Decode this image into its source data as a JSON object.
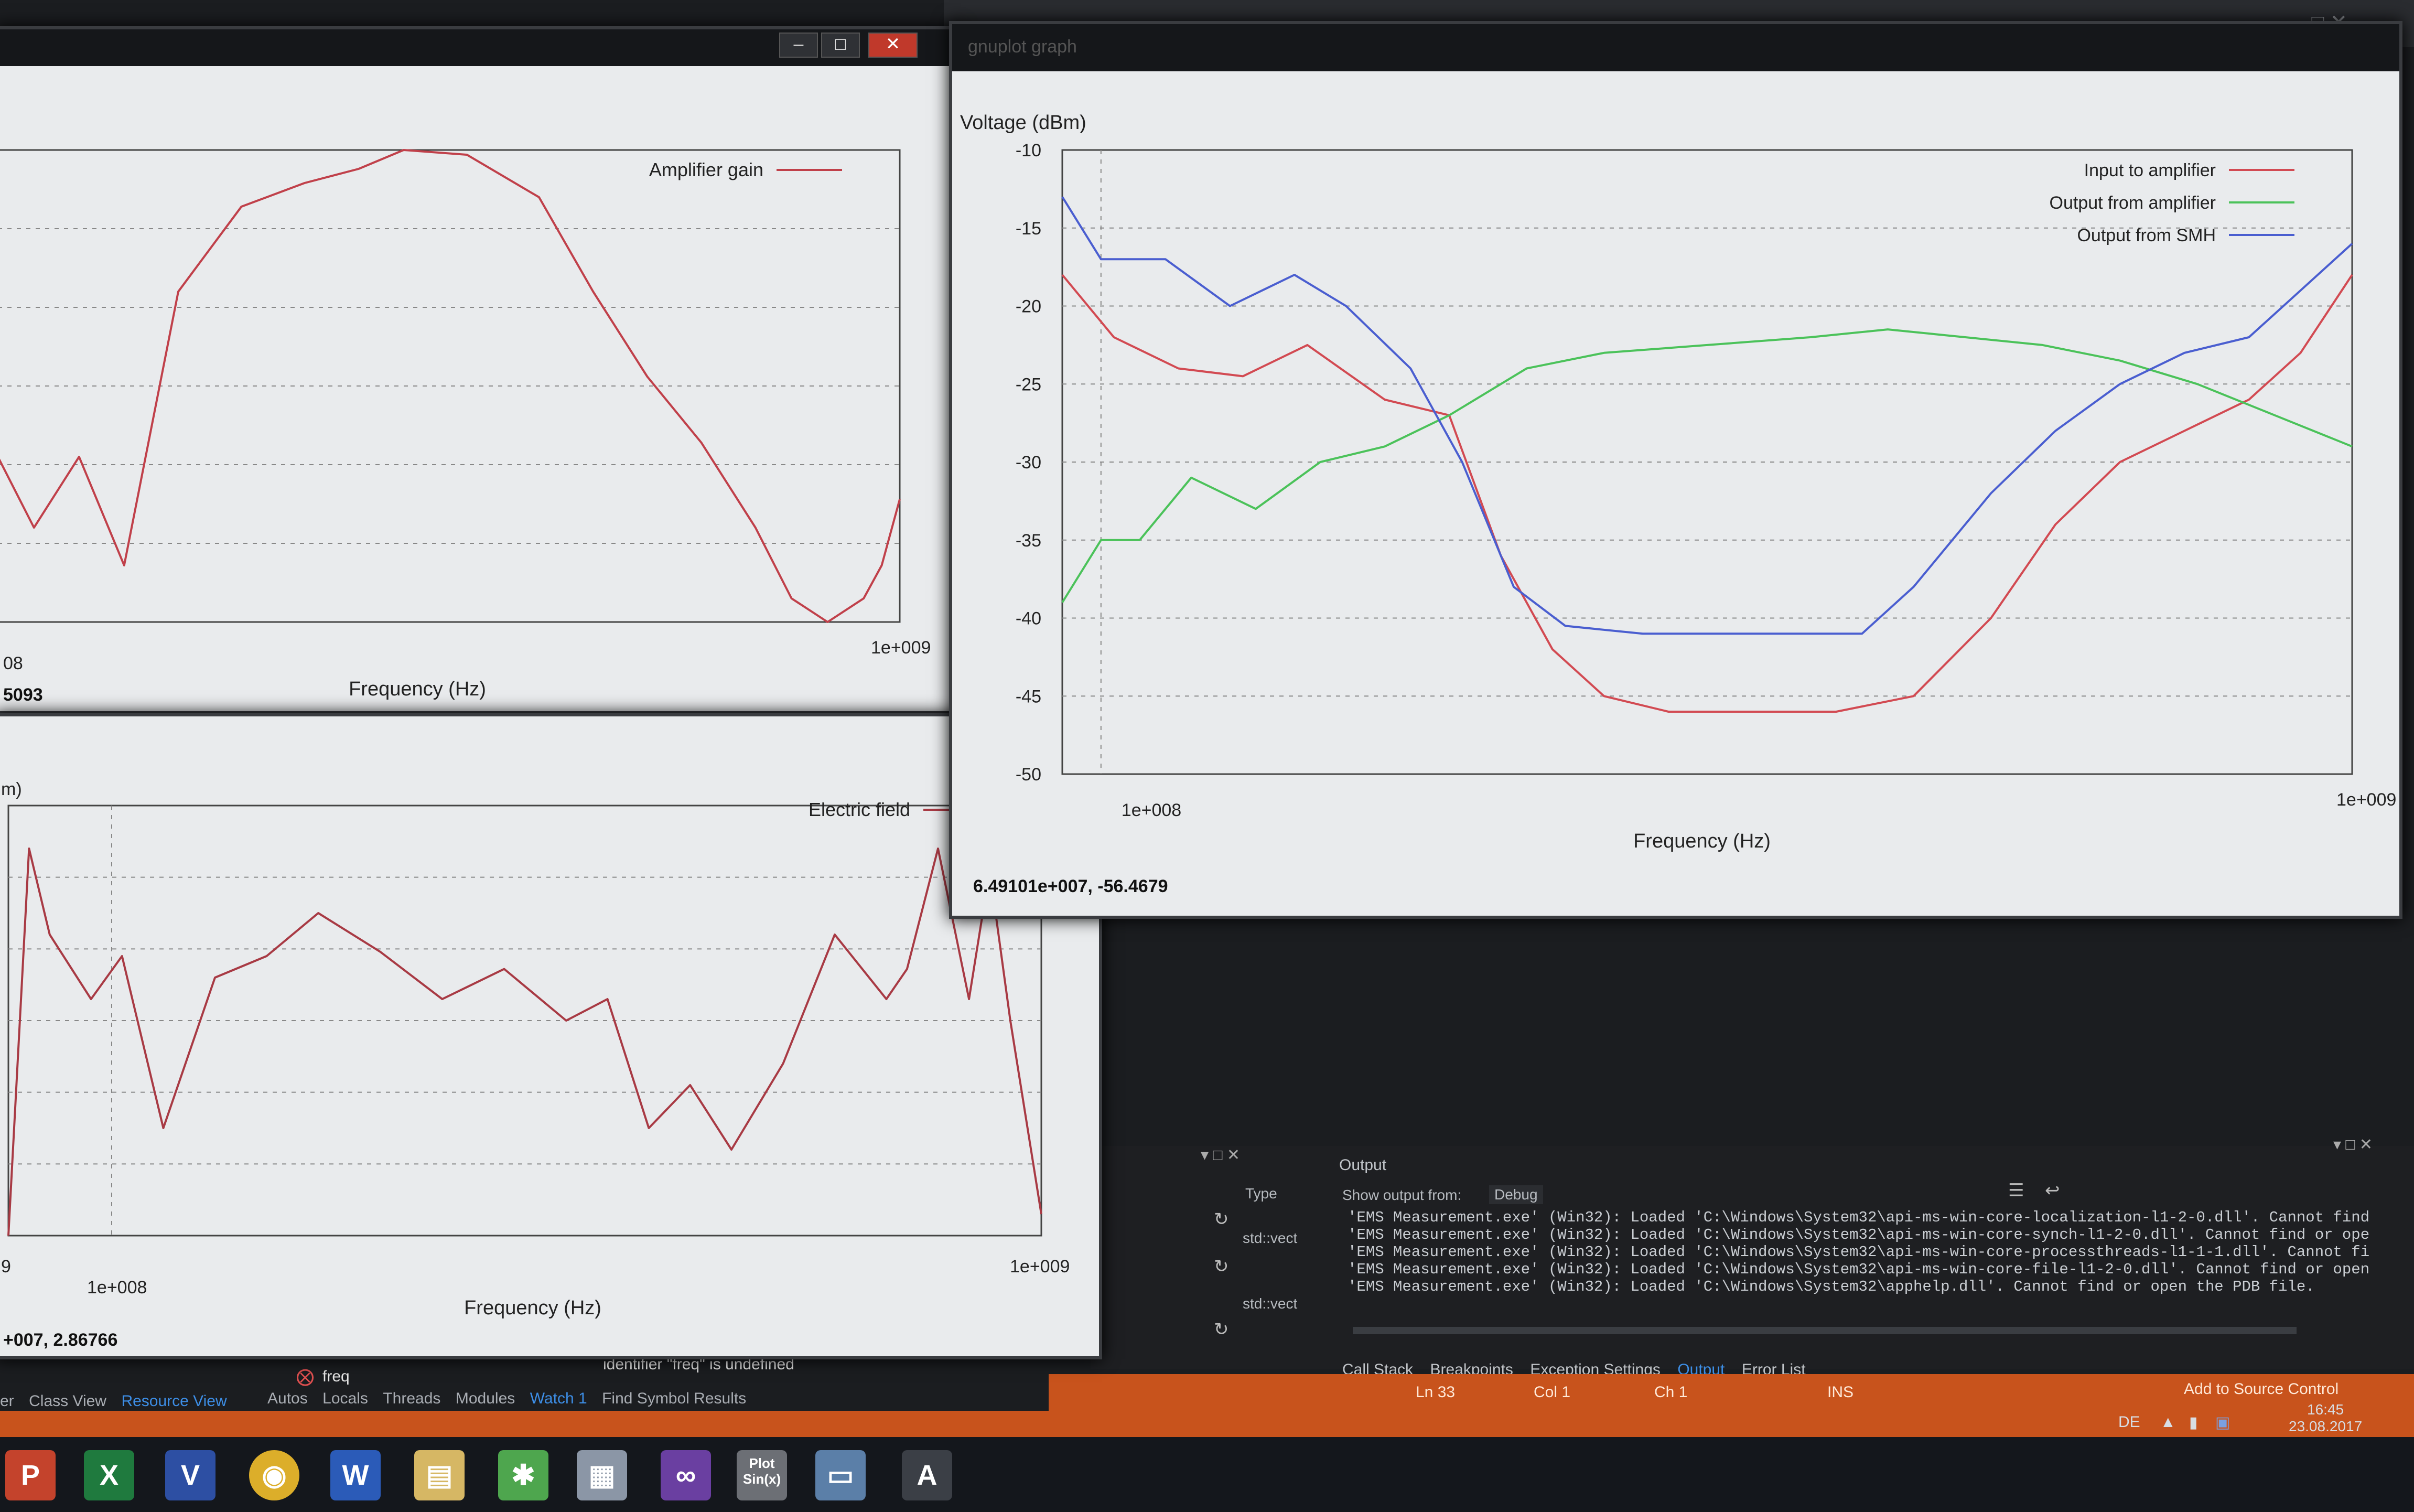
{
  "ide": {
    "output": {
      "title": "Output",
      "show_from_label": "Show output from:",
      "show_from_value": "Debug",
      "lines": [
        "'EMS Measurement.exe' (Win32): Loaded 'C:\\Windows\\System32\\api-ms-win-core-localization-l1-2-0.dll'. Cannot find",
        "'EMS Measurement.exe' (Win32): Loaded 'C:\\Windows\\System32\\api-ms-win-core-synch-l1-2-0.dll'. Cannot find or ope",
        "'EMS Measurement.exe' (Win32): Loaded 'C:\\Windows\\System32\\api-ms-win-core-processthreads-l1-1-1.dll'. Cannot fi",
        "'EMS Measurement.exe' (Win32): Loaded 'C:\\Windows\\System32\\api-ms-win-core-file-l1-2-0.dll'. Cannot find or open",
        "'EMS Measurement.exe' (Win32): Loaded 'C:\\Windows\\System32\\apphelp.dll'. Cannot find or open the PDB file."
      ],
      "tabs": [
        "Call Stack",
        "Breakpoints",
        "Exception Settings",
        "Output",
        "Error List"
      ],
      "active_tab": "Output"
    },
    "watch": {
      "type_header": "Type",
      "types": [
        "std::vect",
        "std::vect"
      ],
      "errors": [
        "identifier \"freq\" is undefined"
      ],
      "items": [
        "freq"
      ]
    },
    "lower_tabs": [
      "er",
      "Class View",
      "Resource View",
      "Autos",
      "Locals",
      "Threads",
      "Modules",
      "Watch 1",
      "Find Symbol Results"
    ],
    "lower_tabs_active": [
      "Resource View",
      "Watch 1"
    ],
    "status": {
      "ln": "Ln 33",
      "col": "Col 1",
      "ch": "Ch 1",
      "ins": "INS",
      "source_control": "Add to Source Control"
    },
    "tray": {
      "lang": "DE",
      "time": "16:45",
      "date": "23.08.2017"
    },
    "taskbar_plot_label": "Plot\nSin(x)"
  },
  "plots": {
    "amplifier_gain": {
      "coord": "5093",
      "xlabel": "Frequency (Hz)",
      "xtick_left": "08",
      "xtick_right": "1e+009",
      "chart_data": {
        "type": "line",
        "xlabel": "Frequency (Hz)",
        "series": [
          {
            "name": "Amplifier gain",
            "color": "#c0404a",
            "x": [
              0,
              0.04,
              0.09,
              0.14,
              0.2,
              0.27,
              0.34,
              0.4,
              0.45,
              0.52,
              0.6,
              0.66,
              0.72,
              0.78,
              0.84,
              0.88,
              0.92,
              0.96,
              0.98,
              1.0
            ],
            "y": [
              0.35,
              0.2,
              0.35,
              0.12,
              0.7,
              0.88,
              0.93,
              0.96,
              1.0,
              0.99,
              0.9,
              0.7,
              0.52,
              0.38,
              0.2,
              0.05,
              0.0,
              0.05,
              0.12,
              0.26
            ]
          }
        ]
      }
    },
    "electric_field": {
      "coord": "+007, 2.86766",
      "ylabel_fragment": "m)",
      "xlabel": "Frequency (Hz)",
      "xtick_left": "1e+008",
      "xtick_right": "1e+009",
      "xtick_far_left": "9",
      "chart_data": {
        "type": "line",
        "xlabel": "Frequency (Hz)",
        "series": [
          {
            "name": "Electric field",
            "color": "#a83a44",
            "x": [
              0,
              0.02,
              0.04,
              0.08,
              0.11,
              0.15,
              0.2,
              0.25,
              0.3,
              0.36,
              0.42,
              0.48,
              0.54,
              0.58,
              0.62,
              0.66,
              0.7,
              0.75,
              0.8,
              0.85,
              0.87,
              0.9,
              0.93,
              0.95,
              0.97,
              1.0
            ],
            "y": [
              0.0,
              0.9,
              0.7,
              0.55,
              0.65,
              0.25,
              0.6,
              0.65,
              0.75,
              0.66,
              0.55,
              0.62,
              0.5,
              0.55,
              0.25,
              0.35,
              0.2,
              0.4,
              0.7,
              0.55,
              0.62,
              0.9,
              0.55,
              0.85,
              0.5,
              0.05
            ]
          }
        ]
      }
    },
    "voltage": {
      "title": "gnuplot graph",
      "coord": "6.49101e+007, -56.4679",
      "ylabel": "Voltage (dBm)",
      "xlabel": "Frequency (Hz)",
      "yticks": [
        "-10",
        "-15",
        "-20",
        "-25",
        "-30",
        "-35",
        "-40",
        "-45",
        "-50"
      ],
      "xtick_left": "1e+008",
      "xtick_right": "1e+009",
      "chart_data": {
        "type": "line",
        "ylabel": "Voltage (dBm)",
        "xlabel": "Frequency (Hz)",
        "ylim": [
          -50,
          -10
        ],
        "xlim": [
          0,
          1
        ],
        "series": [
          {
            "name": "Input to amplifier",
            "color": "#d24a52",
            "x": [
              0,
              0.04,
              0.09,
              0.14,
              0.19,
              0.25,
              0.3,
              0.34,
              0.38,
              0.42,
              0.47,
              0.53,
              0.6,
              0.66,
              0.72,
              0.77,
              0.82,
              0.87,
              0.92,
              0.96,
              1.0
            ],
            "y": [
              -18,
              -22,
              -24,
              -24.5,
              -22.5,
              -26,
              -27,
              -36,
              -42,
              -45,
              -46,
              -46,
              -46,
              -45,
              -40,
              -34,
              -30,
              -28,
              -26,
              -23,
              -18
            ]
          },
          {
            "name": "Output from amplifier",
            "color": "#4bc25a",
            "x": [
              0,
              0.03,
              0.06,
              0.1,
              0.15,
              0.2,
              0.25,
              0.3,
              0.36,
              0.42,
              0.5,
              0.58,
              0.64,
              0.7,
              0.76,
              0.82,
              0.88,
              0.94,
              1.0
            ],
            "y": [
              -39,
              -35,
              -35,
              -31,
              -33,
              -30,
              -29,
              -27,
              -24,
              -23,
              -22.5,
              -22,
              -21.5,
              -22,
              -22.5,
              -23.5,
              -25,
              -27,
              -29
            ]
          },
          {
            "name": "Output from SMH",
            "color": "#4a5ed0",
            "x": [
              0,
              0.03,
              0.08,
              0.13,
              0.18,
              0.22,
              0.27,
              0.31,
              0.35,
              0.39,
              0.45,
              0.5,
              0.56,
              0.62,
              0.66,
              0.72,
              0.77,
              0.82,
              0.87,
              0.92,
              0.96,
              1.0
            ],
            "y": [
              -13,
              -17,
              -17,
              -20,
              -18,
              -20,
              -24,
              -30,
              -38,
              -40.5,
              -41,
              -41,
              -41,
              -41,
              -38,
              -32,
              -28,
              -25,
              -23,
              -22,
              -19,
              -16
            ]
          }
        ]
      }
    }
  },
  "colors": {
    "accent_blue": "#3d8ee6",
    "status_orange": "#c8531c"
  }
}
